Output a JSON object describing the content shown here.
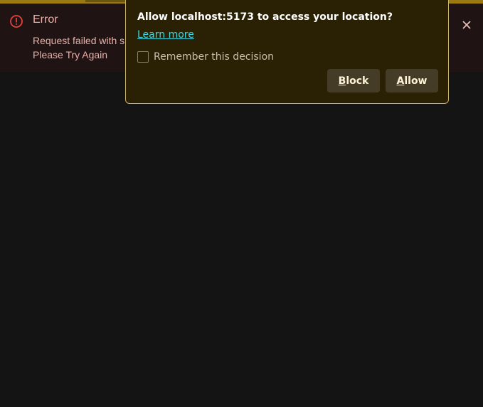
{
  "error_banner": {
    "title": "Error",
    "message_line1": "Request failed with s",
    "message_line2": "Please Try Again",
    "icon": "error-circle-icon",
    "close_icon": "close-icon"
  },
  "permission_popup": {
    "question": "Allow localhost:5173 to access your location?",
    "learn_more": "Learn more",
    "remember_label": "Remember this decision",
    "remember_checked": false,
    "block_label": "Block",
    "allow_label": "Allow"
  },
  "colors": {
    "page_background": "#141414",
    "top_strip": "#9a7a10",
    "error_background": "#1f1313",
    "error_accent": "#e0443c",
    "popup_background": "#2a2105",
    "popup_border": "#c9b36a",
    "link": "#3ed6e3",
    "button_background": "#453c27"
  }
}
